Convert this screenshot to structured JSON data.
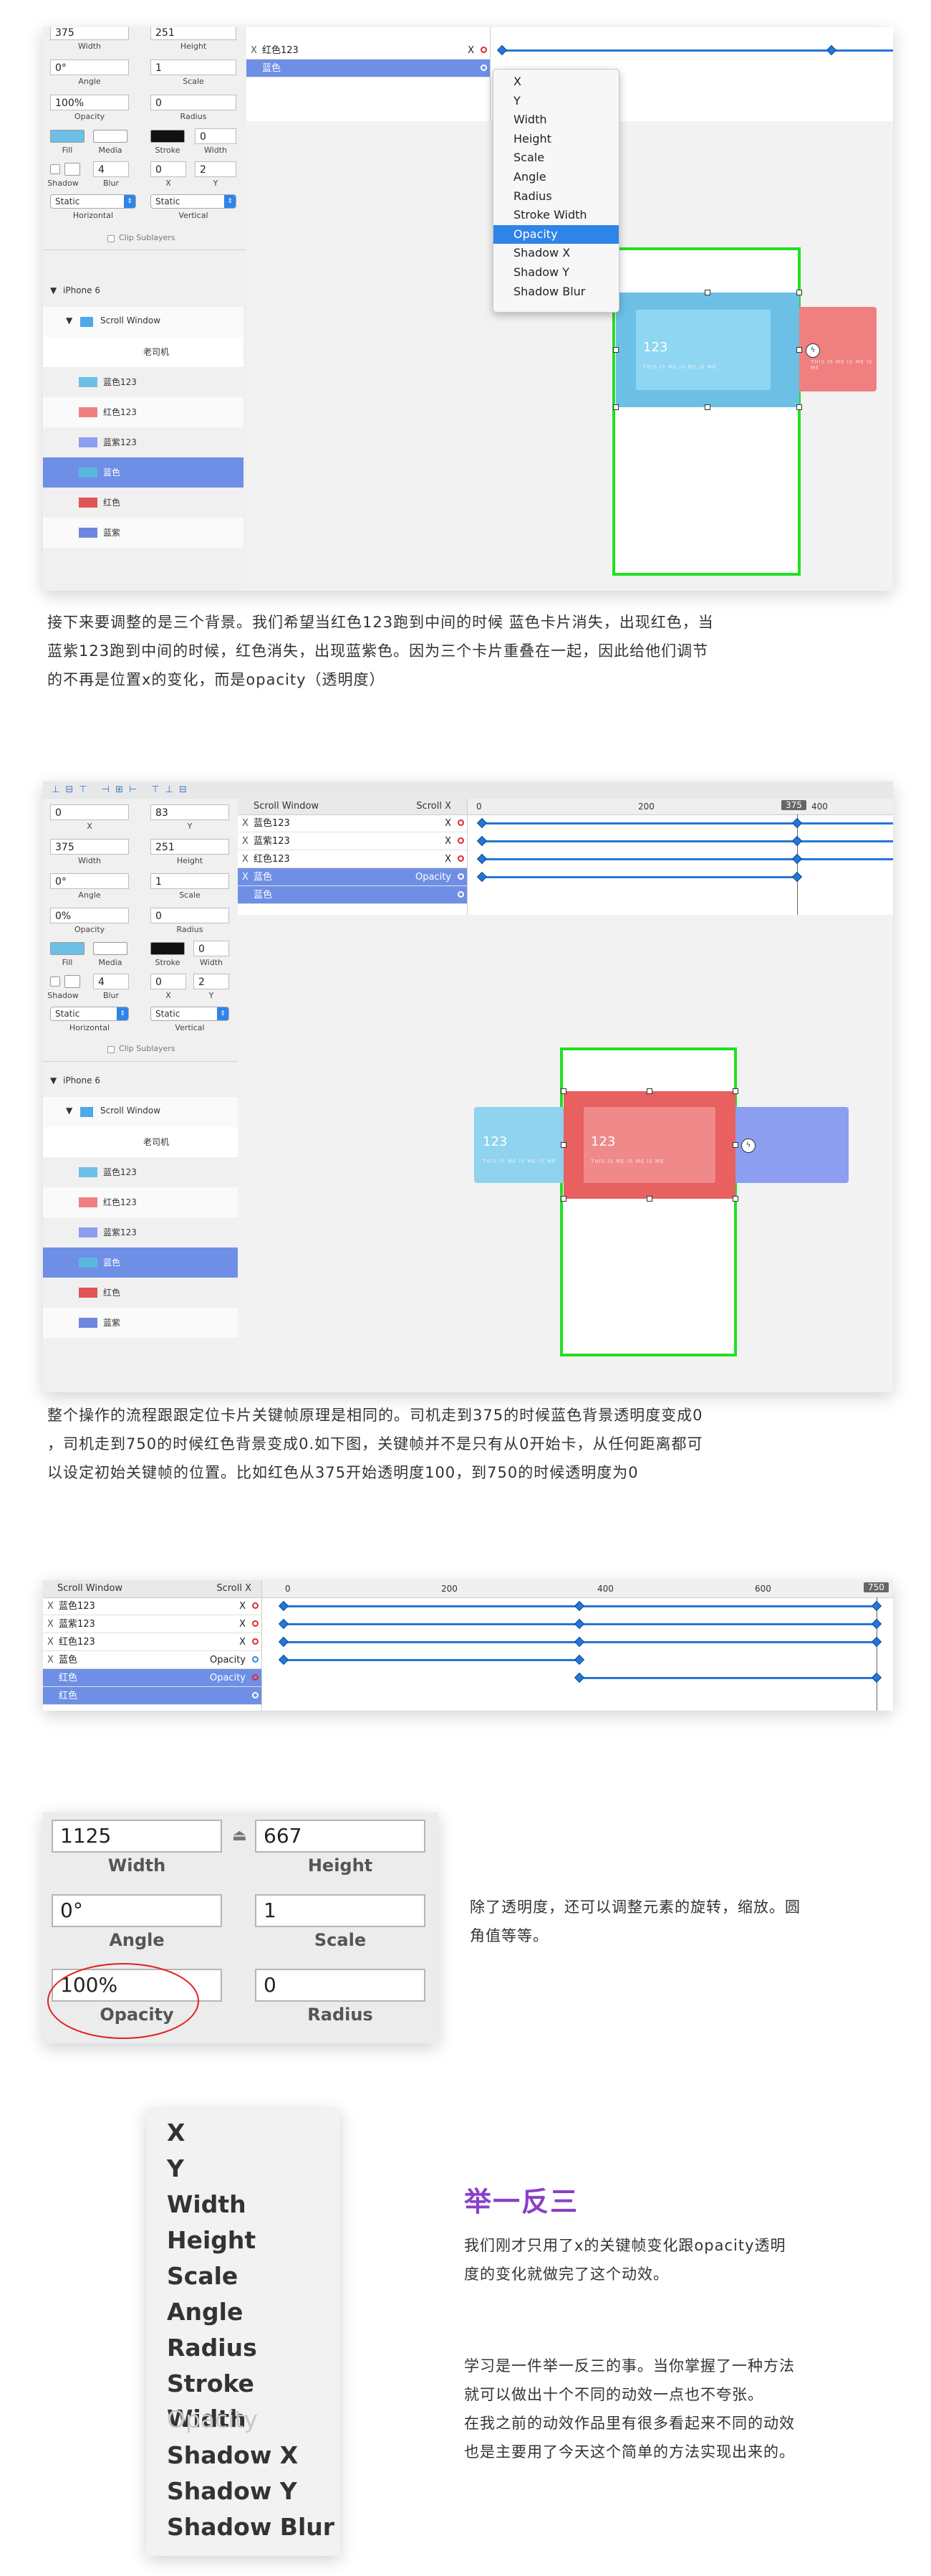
{
  "shot1": {
    "fields": {
      "width_val": "375",
      "height_val": "251",
      "angle_val": "0°",
      "scale_val": "1",
      "opacity_val": "100%",
      "radius_val": "0",
      "stroke_val": "0",
      "blur_val": "4",
      "x_val": "0",
      "y_val": "2"
    },
    "labels": {
      "width": "Width",
      "height": "Height",
      "angle": "Angle",
      "scale": "Scale",
      "opacity": "Opacity",
      "radius": "Radius",
      "fill": "Fill",
      "media": "Media",
      "stroke": "Stroke",
      "width2": "Width",
      "shadow": "Shadow",
      "blur": "Blur",
      "x": "X",
      "y": "Y",
      "horizontal": "Horizontal",
      "vertical": "Vertical",
      "clip": "Clip Sublayers"
    },
    "selects": {
      "horizontal": "Static",
      "vertical": "Static"
    },
    "layers": {
      "device": "iPhone 6",
      "scroll": "Scroll Window",
      "driver": "老司机",
      "l1": "蓝色123",
      "l2": "红色123",
      "l3": "蓝紫123",
      "l4": "蓝色",
      "l5": "红色",
      "l6": "蓝紫"
    },
    "timeline": {
      "row1": "红色123",
      "row2": "蓝色",
      "mark": "X"
    },
    "menu": [
      "X",
      "Y",
      "Width",
      "Height",
      "Scale",
      "Angle",
      "Radius",
      "Stroke Width",
      "Opacity",
      "Shadow X",
      "Shadow Y",
      "Shadow Blur"
    ],
    "cards": {
      "blue": "123",
      "sub": "THIS IS ME IS ME IS ME"
    }
  },
  "para1": [
    "接下来要调整的是三个背景。我们希望当红色123跑到中间的时候 蓝色卡片消失，出现红色，当",
    "蓝紫123跑到中间的时候，红色消失，出现蓝紫色。因为三个卡片重叠在一起，因此给他们调节",
    "的不再是位置x的变化，而是opacity（透明度）"
  ],
  "shot2": {
    "fields": {
      "x_val": "0",
      "y_val": "83",
      "width_val": "375",
      "height_val": "251",
      "angle_val": "0°",
      "scale_val": "1",
      "opacity_val": "0%",
      "radius_val": "0",
      "stroke_val": "0",
      "blur_val": "4",
      "sx_val": "0",
      "sy_val": "2"
    },
    "labels": {
      "x": "X",
      "y": "Y",
      "width": "Width",
      "height": "Height",
      "angle": "Angle",
      "scale": "Scale",
      "opacity": "Opacity",
      "radius": "Radius",
      "fill": "Fill",
      "media": "Media",
      "stroke": "Stroke",
      "width2": "Width",
      "shadow": "Shadow",
      "blur": "Blur",
      "sx": "X",
      "sy": "Y",
      "horizontal": "Horizontal",
      "vertical": "Vertical",
      "clip": "Clip Sublayers"
    },
    "selects": {
      "horizontal": "Static",
      "vertical": "Static"
    },
    "layers": {
      "device": "iPhone 6",
      "scroll": "Scroll Window",
      "driver": "老司机",
      "l1": "蓝色123",
      "l2": "红色123",
      "l3": "蓝紫123",
      "l4": "蓝色",
      "l5": "红色",
      "l6": "蓝紫"
    },
    "timeline": {
      "header": "Scroll Window",
      "header_prop": "Scroll X",
      "r1": "蓝色123",
      "r2": "蓝紫123",
      "r3": "红色123",
      "r4": "蓝色",
      "r4prop": "Opacity",
      "r5": "蓝色",
      "mark": "X",
      "t0": "0",
      "t200": "200",
      "t375": "375",
      "t400": "400"
    },
    "cards": {
      "blue": "123",
      "red": "123",
      "sub": "THIS IS ME IS ME IS ME"
    }
  },
  "para2": [
    "整个操作的流程跟跟定位卡片关键帧原理是相同的。司机走到375的时候蓝色背景透明度变成0",
    "，司机走到750的时候红色背景变成0.如下图，关键帧并不是只有从0开始卡，从任何距离都可",
    "以设定初始关键帧的位置。比如红色从375开始透明度100，到750的时候透明度为0"
  ],
  "shot3": {
    "timeline": {
      "header": "Scroll Window",
      "header_prop": "Scroll X",
      "r1": "蓝色123",
      "r2": "蓝紫123",
      "r3": "红色123",
      "r4": "蓝色",
      "r4prop": "Opacity",
      "r5": "红色",
      "r5prop": "Opacity",
      "r6": "红色",
      "mark": "X",
      "t0": "0",
      "t200": "200",
      "t400": "400",
      "t600": "600",
      "t750": "750"
    }
  },
  "shot4": {
    "fields": {
      "width_val": "1125",
      "height_val": "667",
      "angle_val": "0°",
      "scale_val": "1",
      "opacity_val": "100%",
      "radius_val": "0"
    },
    "labels": {
      "width": "Width",
      "height": "Height",
      "angle": "Angle",
      "scale": "Scale",
      "opacity": "Opacity",
      "radius": "Radius"
    }
  },
  "para3": [
    "除了透明度，还可以调整元素的旋转，缩放。圆",
    "角值等等。"
  ],
  "menu_big": [
    "X",
    "Y",
    "Width",
    "Height",
    "Scale",
    "Angle",
    "Radius",
    "Stroke Width",
    "Opacity",
    "Shadow X",
    "Shadow Y",
    "Shadow Blur"
  ],
  "section": {
    "title": "举一反三",
    "p1": [
      "我们刚才只用了x的关键帧变化跟opacity透明",
      "度的变化就做完了这个动效。"
    ],
    "p2": [
      "学习是一件举一反三的事。当你掌握了一种方法",
      "就可以做出十个不同的动效一点也不夸张。",
      "在我之前的动效作品里有很多看起来不同的动效",
      "也是主要用了今天这个简单的方法实现出来的。"
    ]
  },
  "colors": {
    "accent": "#2f84e8",
    "blue_card": "#6cc0e6",
    "red_card": "#f08080",
    "purple_card": "#8c9ef0",
    "green_frame": "#22e022",
    "title_purple": "#8a3fc9"
  }
}
